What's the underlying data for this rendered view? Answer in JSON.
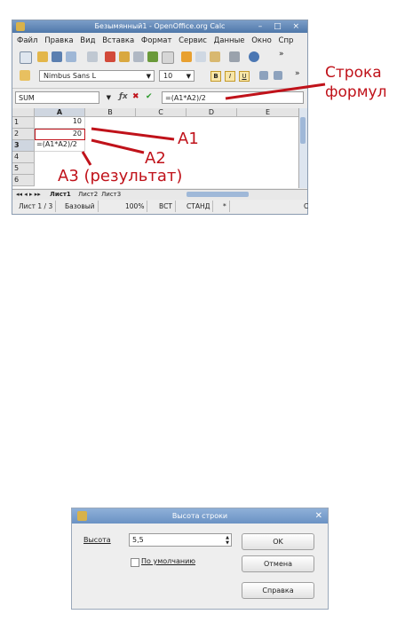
{
  "window": {
    "title": "Безымянный1 - OpenOffice.org Calc",
    "controls": "– □ ×"
  },
  "menu": [
    "Файл",
    "Правка",
    "Вид",
    "Вставка",
    "Формат",
    "Сервис",
    "Данные",
    "Окно",
    "Спр"
  ],
  "format_bar": {
    "font_name": "Nimbus Sans L",
    "font_size": "10",
    "bold": "B",
    "italic": "I",
    "underline": "U"
  },
  "formula_bar": {
    "name_box": "SUM",
    "formula": "=(A1*A2)/2"
  },
  "grid": {
    "columns": [
      "A",
      "B",
      "C",
      "D",
      "E"
    ],
    "rows": [
      "1",
      "2",
      "3",
      "4",
      "5",
      "6"
    ],
    "cells": {
      "A1": "10",
      "A2": "20",
      "A3": "=(A1*A2)/2"
    }
  },
  "sheets": [
    "Лист1",
    "Лист2",
    "Лист3"
  ],
  "status": {
    "sheet": "Лист 1 / 3",
    "style": "Базовый",
    "zoom": "100%",
    "mode1": "ВСТ",
    "mode2": "СТАНД",
    "star": "*",
    "last": "С"
  },
  "annotations": {
    "formula_line": "Строка",
    "formula_line2": "формул",
    "a1": "A1",
    "a2": "A2",
    "a3": "A3 (результат)"
  },
  "dialog": {
    "title": "Высота строки",
    "height_label": "Высота",
    "height_value": "5,5",
    "default_label": "По умолчанию",
    "ok": "OK",
    "cancel": "Отмена",
    "help": "Справка"
  },
  "colors": {
    "annotation": "#c0121a",
    "title_bar": "#5a82b4"
  }
}
